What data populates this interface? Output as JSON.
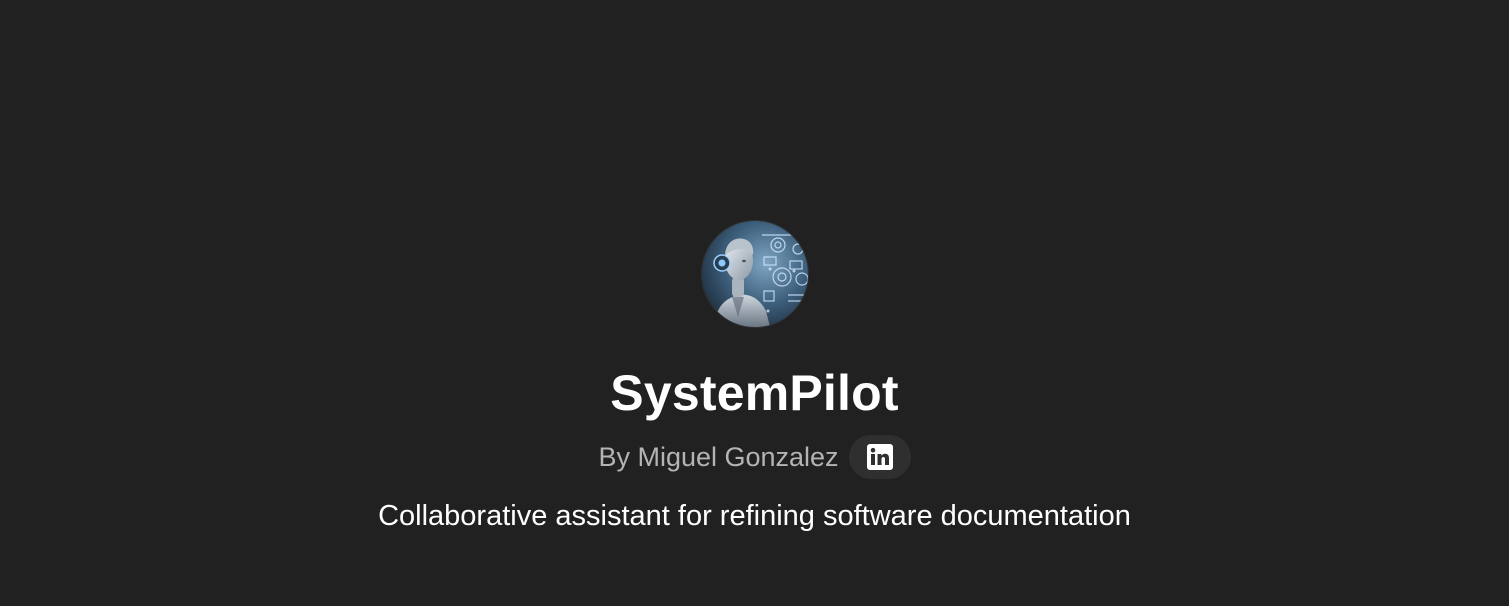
{
  "gpt": {
    "name": "SystemPilot",
    "author": "By Miguel Gonzalez",
    "description": "Collaborative assistant for refining software documentation",
    "social_icon": "linkedin-icon"
  },
  "colors": {
    "background": "#212121",
    "title": "#ffffff",
    "author": "#b4b4b4",
    "badge_background": "#2f2f2f"
  }
}
